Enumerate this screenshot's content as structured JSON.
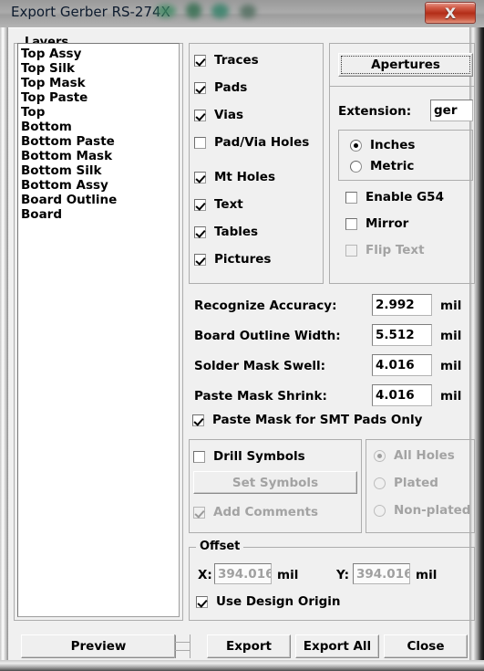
{
  "window": {
    "title": "Export Gerber RS-274X",
    "close_label": "X",
    "close_icon": "close-icon"
  },
  "layers": {
    "group_title": "Layers",
    "items": [
      "Top Assy",
      "Top Silk",
      "Top Mask",
      "Top Paste",
      "Top",
      "Bottom",
      "Bottom Paste",
      "Bottom Mask",
      "Bottom Silk",
      "Bottom Assy",
      "Board Outline",
      "Board"
    ]
  },
  "objects": {
    "checkboxes": [
      {
        "label": "Traces",
        "checked": true,
        "enabled": true
      },
      {
        "label": "Pads",
        "checked": true,
        "enabled": true
      },
      {
        "label": "Vias",
        "checked": true,
        "enabled": true
      },
      {
        "label": "Pad/Via Holes",
        "checked": false,
        "enabled": true
      },
      {
        "label": "Mt Holes",
        "checked": true,
        "enabled": true
      },
      {
        "label": "Text",
        "checked": true,
        "enabled": true
      },
      {
        "label": "Tables",
        "checked": true,
        "enabled": true
      },
      {
        "label": "Pictures",
        "checked": true,
        "enabled": true
      }
    ]
  },
  "format": {
    "apertures_label": "Apertures",
    "extension_label": "Extension:",
    "extension_value": "ger",
    "units": {
      "options": [
        "Inches",
        "Metric"
      ],
      "selected": "Inches"
    },
    "enable_g54": {
      "label": "Enable G54",
      "checked": false,
      "enabled": true
    },
    "mirror": {
      "label": "Mirror",
      "checked": false,
      "enabled": true
    },
    "flip_text": {
      "label": "Flip Text",
      "checked": false,
      "enabled": false
    }
  },
  "parameters": {
    "unit_suffix": "mil",
    "fields": [
      {
        "label": "Recognize Accuracy:",
        "value": "2.992",
        "unit": "mil"
      },
      {
        "label": "Board Outline Width:",
        "value": "5.512",
        "unit": "mil"
      },
      {
        "label": "Solder Mask Swell:",
        "value": "4.016",
        "unit": "mil"
      },
      {
        "label": "Paste Mask Shrink:",
        "value": "4.016",
        "unit": "mil"
      }
    ],
    "paste_mask_smt": {
      "label": "Paste Mask for SMT Pads Only",
      "checked": true,
      "enabled": true
    }
  },
  "drill": {
    "drill_symbols": {
      "label": "Drill Symbols",
      "checked": false,
      "enabled": true
    },
    "set_symbols": {
      "label": "Set Symbols",
      "enabled": false
    },
    "add_comments": {
      "label": "Add Comments",
      "checked": true,
      "enabled": false
    },
    "holes": {
      "options": [
        "All Holes",
        "Plated",
        "Non-plated"
      ],
      "selected": "All Holes",
      "enabled": false
    }
  },
  "offset": {
    "group_title": "Offset",
    "x_label": "X:",
    "x_value": "394.016",
    "x_unit": "mil",
    "y_label": "Y:",
    "y_value": "394.016",
    "y_unit": "mil",
    "use_design_origin": {
      "label": "Use Design Origin",
      "checked": true,
      "enabled": true
    }
  },
  "footer": {
    "preview": "Preview",
    "export": "Export",
    "export_all": "Export All",
    "close": "Close"
  },
  "colors": {
    "dialog_face": "#f0f0f0",
    "titlebar": "#a8a8a8",
    "close_red": "#b32d18",
    "field_bg": "#ffffff",
    "disabled_text": "#a3a3a3"
  }
}
